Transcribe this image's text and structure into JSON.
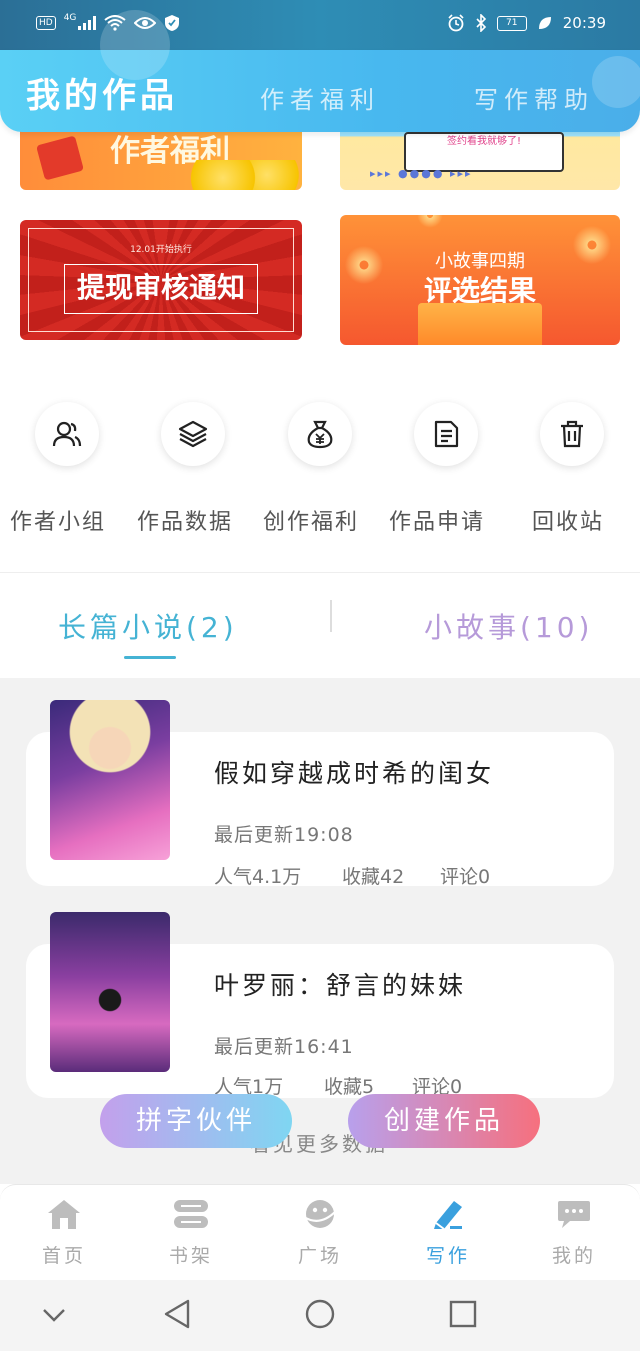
{
  "status_bar": {
    "hd": "HD",
    "network": "4G",
    "battery": "71",
    "time": "20:39"
  },
  "header": {
    "title": "我的作品",
    "tabs": [
      "作者福利",
      "写作帮助"
    ]
  },
  "banners": {
    "b1_text": "作者福利",
    "b2_text": "签约看我就够了!",
    "b3_small": "12.01开始执行",
    "b3_big": "提现审核通知",
    "b4_line1": "小故事四期",
    "b4_line2": "评选结果"
  },
  "quick_actions": [
    {
      "label": "作者小组",
      "icon": "users-icon"
    },
    {
      "label": "作品数据",
      "icon": "layers-icon"
    },
    {
      "label": "创作福利",
      "icon": "money-bag-icon"
    },
    {
      "label": "作品申请",
      "icon": "document-icon"
    },
    {
      "label": "回收站",
      "icon": "trash-icon"
    }
  ],
  "tabs": {
    "long_novel": "长篇小说(2)",
    "short_story": "小故事(10)"
  },
  "books": [
    {
      "title": "假如穿越成时希的闺女",
      "last_update": "最后更新19:08",
      "popularity": "人气4.1万",
      "favorites": "收藏42",
      "comments": "评论0"
    },
    {
      "title": "叶罗丽：舒言的妹妹",
      "last_update": "最后更新16:41",
      "popularity": "人气1万",
      "favorites": "收藏5",
      "comments": "评论0"
    }
  ],
  "buttons": {
    "partner": "拼字伙伴",
    "create": "创建作品"
  },
  "more_text": "看见更多数据",
  "bottom_nav": [
    {
      "label": "首页",
      "icon": "home-icon",
      "active": false
    },
    {
      "label": "书架",
      "icon": "bookshelf-icon",
      "active": false
    },
    {
      "label": "广场",
      "icon": "planet-icon",
      "active": false
    },
    {
      "label": "写作",
      "icon": "pen-icon",
      "active": true
    },
    {
      "label": "我的",
      "icon": "chat-icon",
      "active": false
    }
  ],
  "colors": {
    "header_gradient_start": "#5ad0f5",
    "header_gradient_end": "#4aaee9",
    "accent_blue": "#45b3d4",
    "accent_purple": "#b69ad9",
    "nav_active": "#3aa0de"
  }
}
